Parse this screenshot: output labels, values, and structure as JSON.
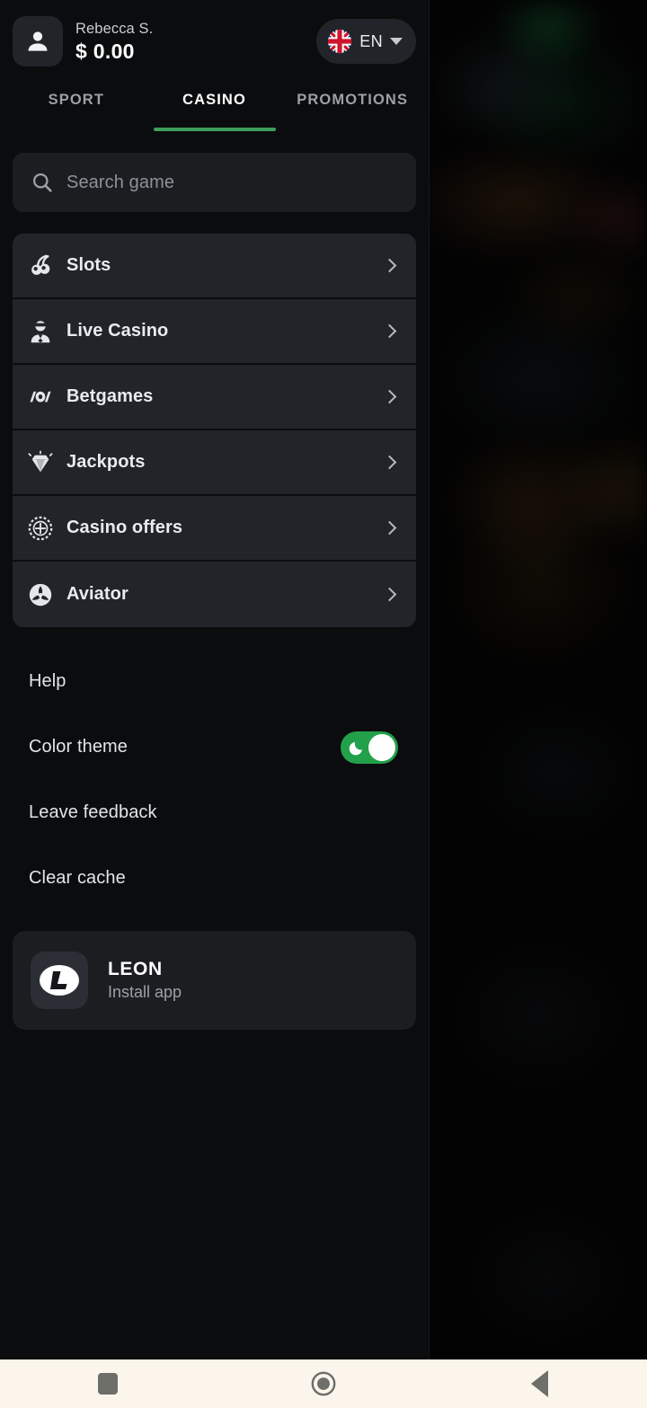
{
  "account": {
    "avatar_icon": "person-icon",
    "user_name": "Rebecca S.",
    "balance": "$ 0.00"
  },
  "language": {
    "flag_icon": "uk-flag-icon",
    "code": "EN",
    "caret_icon": "chevron-down-icon"
  },
  "tabs": [
    {
      "label": "SPORT",
      "active": false
    },
    {
      "label": "CASINO",
      "active": true
    },
    {
      "label": "PROMOTIONS",
      "active": false
    }
  ],
  "search": {
    "icon": "search-icon",
    "placeholder": "Search game"
  },
  "menu": [
    {
      "label": "Slots",
      "icon": "cherries-icon"
    },
    {
      "label": "Live Casino",
      "icon": "dealer-icon"
    },
    {
      "label": "Betgames",
      "icon": "betgames-icon"
    },
    {
      "label": "Jackpots",
      "icon": "diamond-icon"
    },
    {
      "label": "Casino offers",
      "icon": "casino-chip-icon"
    },
    {
      "label": "Aviator",
      "icon": "aviator-propeller-icon"
    }
  ],
  "settings": [
    {
      "label": "Help",
      "type": "link"
    },
    {
      "label": "Color theme",
      "type": "toggle",
      "toggle_on": true,
      "toggle_icon": "moon-icon"
    },
    {
      "label": "Leave feedback",
      "type": "link"
    },
    {
      "label": "Clear cache",
      "type": "link"
    }
  ],
  "install": {
    "logo_icon": "leon-logo-icon",
    "title": "LEON",
    "subtitle": "Install app"
  },
  "navbar": {
    "recents_icon": "square-recents-icon",
    "home_icon": "circle-home-icon",
    "back_icon": "triangle-back-icon"
  },
  "colors": {
    "accent_green": "#3f9e5c",
    "toggle_green": "#22a04a",
    "drawer_bg": "#0b0c0e",
    "row_bg": "#212429",
    "search_bg": "#1b1d21",
    "navbar_bg": "#fbf5ec"
  }
}
